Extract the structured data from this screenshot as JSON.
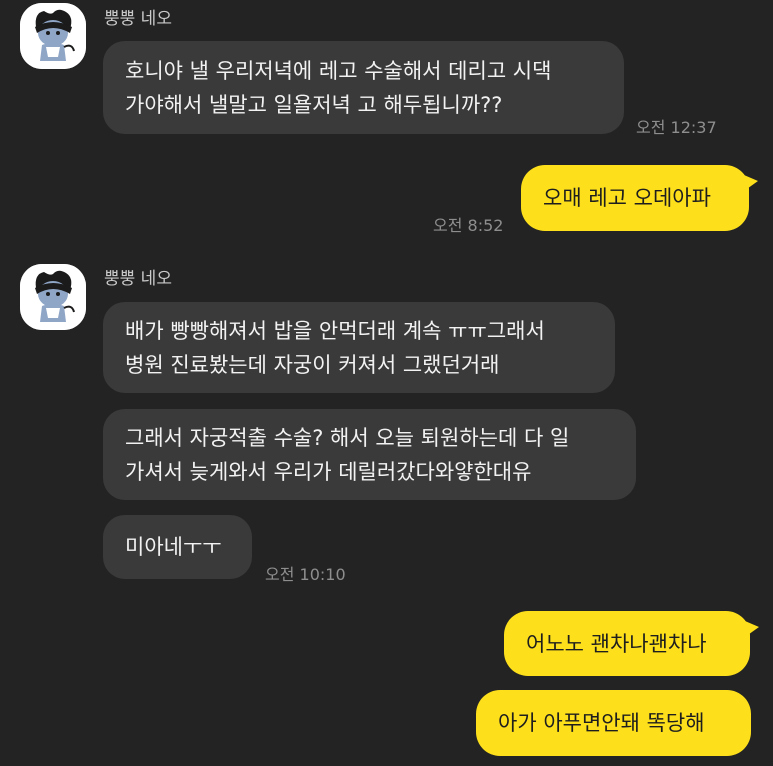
{
  "colors": {
    "background": "#232323",
    "received_bubble": "#3a3a3a",
    "sent_bubble": "#fde01b",
    "timestamp": "#8e8e8e",
    "sender_name": "#c9c9c9"
  },
  "groups": [
    {
      "sender": "뿡뿡 네오",
      "avatar_icon": "neo-profile-icon",
      "messages": [
        "호니야 낼 우리저녁에 레고 수술해서 데리고 시댁\n가야해서 낼말고 일욜저녁 고 해두됩니까??"
      ],
      "time": "오전 12:37"
    },
    {
      "sender": "",
      "messages": [
        "오매 레고 오데아파"
      ],
      "time": "오전 8:52"
    },
    {
      "sender": "뿡뿡 네오",
      "avatar_icon": "neo-profile-icon",
      "messages": [
        "배가 빵빵해져서 밥을 안먹더래 계속 ㅠㅠ그래서\n병원 진료봤는데 자궁이 커져서 그랬던거래",
        "그래서 자궁적출 수술? 해서 오늘 퇴원하는데 다 일\n가셔서 늦게와서 우리가 데릴러갔다와얗한대유",
        "미아네ㅜㅜ"
      ],
      "time": "오전 10:10"
    },
    {
      "sender": "",
      "messages": [
        "어노노 괜차나괜차나",
        "아가 아푸면안돼 똑당해"
      ],
      "time": ""
    }
  ]
}
